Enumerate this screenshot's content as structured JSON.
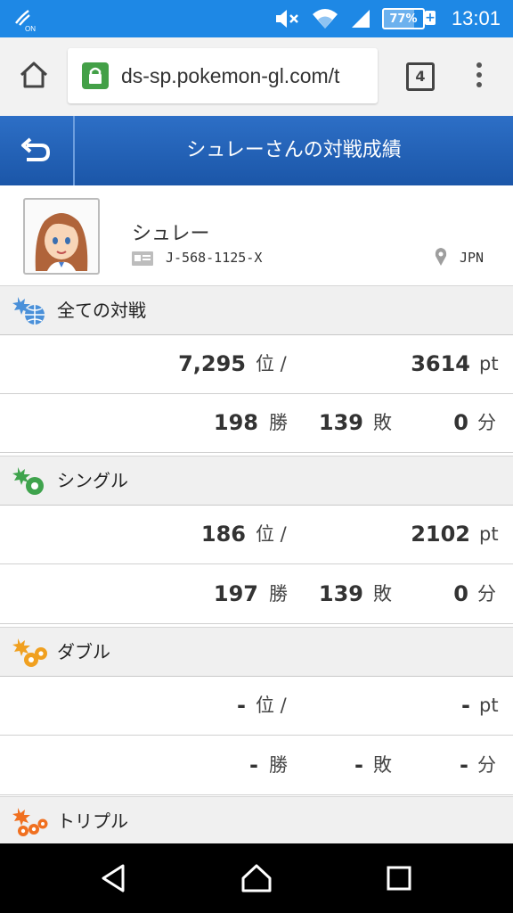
{
  "status_bar": {
    "time": "13:01",
    "battery_percent": "77%",
    "battery_level": 0.77,
    "nfc_label": "ON",
    "icons": [
      "nfc-icon",
      "mute-icon",
      "wifi-icon",
      "signal-icon",
      "battery-icon"
    ]
  },
  "browser": {
    "url": "ds-sp.pokemon-gl.com/t",
    "tab_count": "4"
  },
  "header": {
    "title": "シュレーさんの対戦成績"
  },
  "profile": {
    "name": "シュレー",
    "id": "J-568-1125-X",
    "country": "JPN"
  },
  "sections": [
    {
      "title": "全ての対戦",
      "icon": "globe-icon",
      "rank": "7,295",
      "rank_unit": "位 /",
      "points": "3614",
      "points_unit": "pt",
      "wins": "198",
      "wins_unit": "勝",
      "losses": "139",
      "losses_unit": "敗",
      "draws": "0",
      "draws_unit": "分"
    },
    {
      "title": "シングル",
      "icon": "single-battle-icon",
      "rank": "186",
      "rank_unit": "位 /",
      "points": "2102",
      "points_unit": "pt",
      "wins": "197",
      "wins_unit": "勝",
      "losses": "139",
      "losses_unit": "敗",
      "draws": "0",
      "draws_unit": "分"
    },
    {
      "title": "ダブル",
      "icon": "double-battle-icon",
      "rank": "-",
      "rank_unit": "位 /",
      "points": "-",
      "points_unit": "pt",
      "wins": "-",
      "wins_unit": "勝",
      "losses": "-",
      "losses_unit": "敗",
      "draws": "-",
      "draws_unit": "分"
    },
    {
      "title": "トリプル",
      "icon": "triple-battle-icon"
    }
  ],
  "colors": {
    "status_bar": "#1e88e5",
    "header": "#2163b8",
    "section_bg": "#f0f0f0",
    "globe_icon": "#4a90d9",
    "single_icon": "#3fa34d",
    "double_icon": "#f0a020",
    "triple_icon": "#f07020"
  }
}
